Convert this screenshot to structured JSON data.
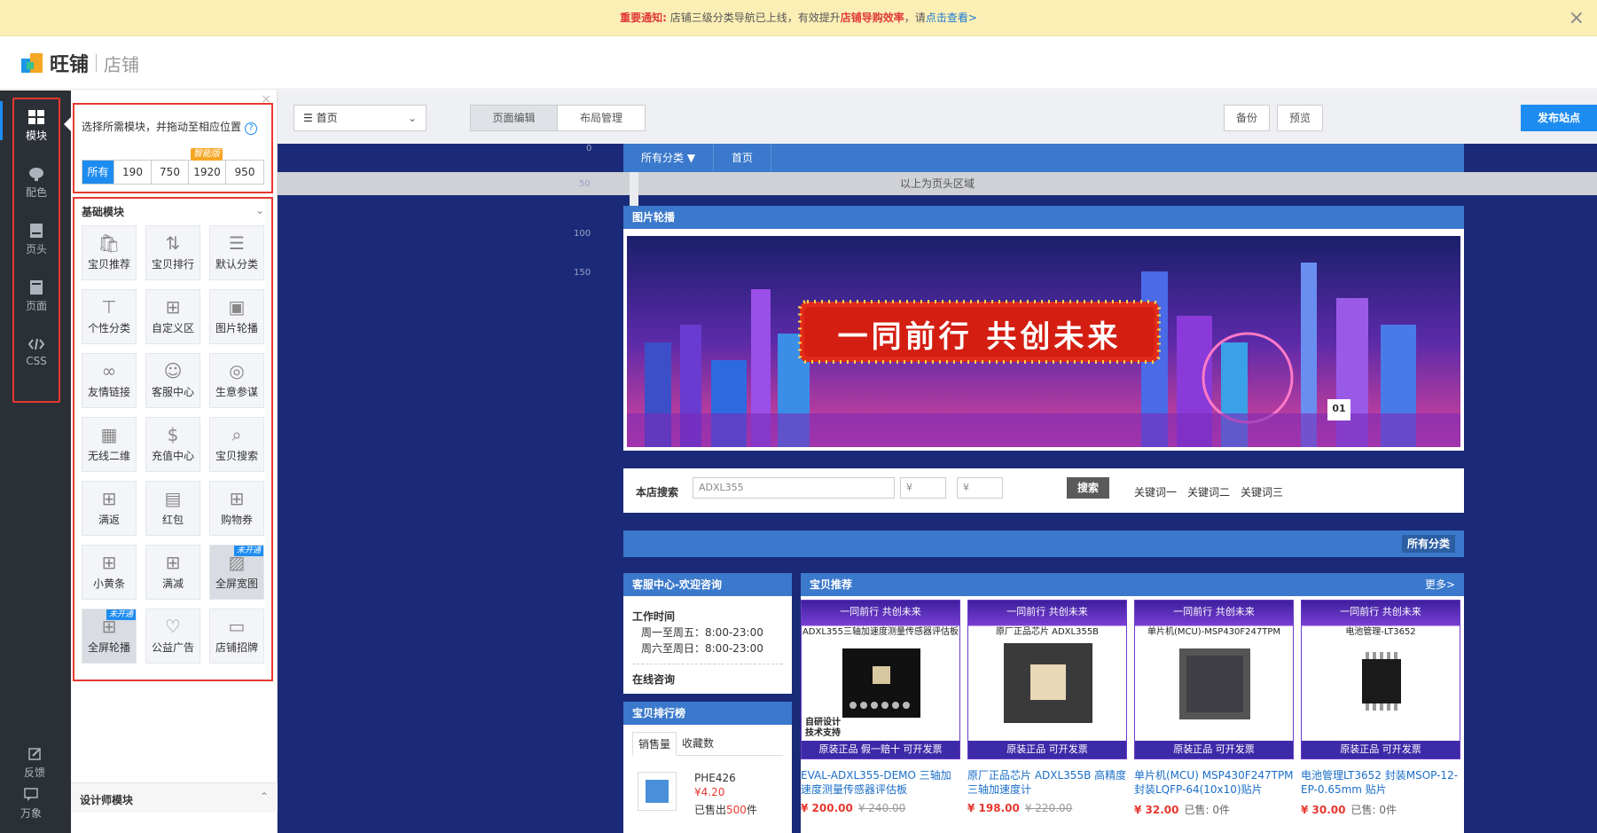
{
  "notice": {
    "label": "重要通知:",
    "text1": "店铺三级分类导航已上线，有效提升",
    "highlight": "店铺导购效率",
    "text2": "，请",
    "link": "点击查看>",
    "close": "×"
  },
  "brand": {
    "name": "旺铺",
    "sub": "店铺"
  },
  "rail": {
    "items": [
      {
        "label": "模块",
        "icon": "grid-icon"
      },
      {
        "label": "配色",
        "icon": "palette-icon"
      },
      {
        "label": "页头",
        "icon": "page-header-icon"
      },
      {
        "label": "页面",
        "icon": "page-icon"
      },
      {
        "label": "CSS",
        "icon": "code-icon"
      }
    ],
    "bottom": [
      {
        "label": "反馈",
        "icon": "edit-icon"
      },
      {
        "label": "万象",
        "icon": "chat-icon"
      }
    ]
  },
  "panel": {
    "tip": "选择所需模块，并拖动至相应位置",
    "help": "?",
    "filters": [
      "所有",
      "190",
      "750",
      "1920",
      "950"
    ],
    "smart_badge": "智能版",
    "basic_title": "基础模块",
    "modules": [
      {
        "label": "宝贝推荐",
        "icon": "bag-icon"
      },
      {
        "label": "宝贝排行",
        "icon": "sort-icon"
      },
      {
        "label": "默认分类",
        "icon": "category-icon"
      },
      {
        "label": "个性分类",
        "icon": "tree-icon"
      },
      {
        "label": "自定义区",
        "icon": "custom-grid-icon"
      },
      {
        "label": "图片轮播",
        "icon": "image-carousel-icon"
      },
      {
        "label": "友情链接",
        "icon": "link-icon"
      },
      {
        "label": "客服中心",
        "icon": "service-icon"
      },
      {
        "label": "生意参谋",
        "icon": "compass-icon"
      },
      {
        "label": "无线二维",
        "icon": "qrcode-icon"
      },
      {
        "label": "充值中心",
        "icon": "dollar-icon"
      },
      {
        "label": "宝贝搜索",
        "icon": "search-icon"
      },
      {
        "label": "满返",
        "icon": "grid-icon"
      },
      {
        "label": "红包",
        "icon": "red-packet-icon"
      },
      {
        "label": "购物券",
        "icon": "grid-icon"
      },
      {
        "label": "小黄条",
        "icon": "grid-icon"
      },
      {
        "label": "满减",
        "icon": "grid-icon"
      },
      {
        "label": "全屏宽图",
        "icon": "wide-image-icon",
        "tag": "未开通"
      },
      {
        "label": "全屏轮播",
        "icon": "grid-icon",
        "tag": "未开通"
      },
      {
        "label": "公益广告",
        "icon": "heart-icon"
      },
      {
        "label": "店铺招牌",
        "icon": "signboard-icon"
      }
    ],
    "designer_title": "设计师模块"
  },
  "toolbar": {
    "page_select": "首页",
    "tabs": [
      "页面编辑",
      "布局管理"
    ],
    "backup": "备份",
    "preview": "预览",
    "publish": "发布站点"
  },
  "canvas": {
    "ruler": [
      "0",
      "50",
      "100",
      "150"
    ],
    "nav": [
      "所有分类 ▼",
      "首页"
    ],
    "header_area": "以上为页头区域",
    "slider_title": "图片轮播",
    "banner_text": "一同前行 共创未来",
    "banner_index": "01",
    "search": {
      "label": "本店搜索",
      "value": "ADXL355",
      "min": "¥",
      "max": "¥",
      "button": "搜索",
      "keywords": [
        "关键词一",
        "关键词二",
        "关键词三"
      ]
    },
    "category_button": "所有分类",
    "service": {
      "title": "客服中心-欢迎咨询",
      "hours_title": "工作时间",
      "weekday": "周一至周五：8:00-23:00",
      "weekend": "周六至周日：8:00-23:00",
      "online": "在线咨询"
    },
    "rank": {
      "title": "宝贝排行榜",
      "tabs": [
        "销售量",
        "收藏数"
      ],
      "item_name": "PHE426",
      "item_price": "¥4.20",
      "sold_prefix": "已售出",
      "sold_count": "500",
      "sold_suffix": "件"
    },
    "recommend": {
      "title": "宝贝推荐",
      "more": "更多>",
      "items": [
        {
          "banner": "一同前行 共创未来",
          "subtitle": "ADXL355三轴加速度测量传感器评估板",
          "footer": "原装正品 假一赔十 可开发票",
          "side": "自研设计 技术支持",
          "name": "EVAL-ADXL355-DEMO 三轴加速度测量传感器评估板",
          "price": "¥ 200.00",
          "old": "¥ 240.00",
          "sold": ""
        },
        {
          "banner": "一同前行 共创未来",
          "subtitle": "原厂正品芯片 ADXL355B",
          "footer": "原装正品 可开发票",
          "side": "",
          "name": "原厂正品芯片 ADXL355B 高精度三轴加速度计",
          "price": "¥ 198.00",
          "old": "¥ 220.00",
          "sold": ""
        },
        {
          "banner": "一同前行 共创未来",
          "subtitle": "单片机(MCU)-MSP430F247TPM",
          "footer": "原装正品 可开发票",
          "side": "",
          "name": "单片机(MCU) MSP430F247TPM 封装LQFP-64(10x10)贴片",
          "price": "¥ 32.00",
          "old": "",
          "sold": "已售: 0件"
        },
        {
          "banner": "一同前行 共创未来",
          "subtitle": "电池管理-LT3652",
          "footer": "原装正品 可开发票",
          "side": "",
          "name": "电池管理LT3652 封装MSOP-12-EP-0.65mm 贴片",
          "price": "¥ 30.00",
          "old": "",
          "sold": "已售: 0件"
        }
      ]
    }
  }
}
